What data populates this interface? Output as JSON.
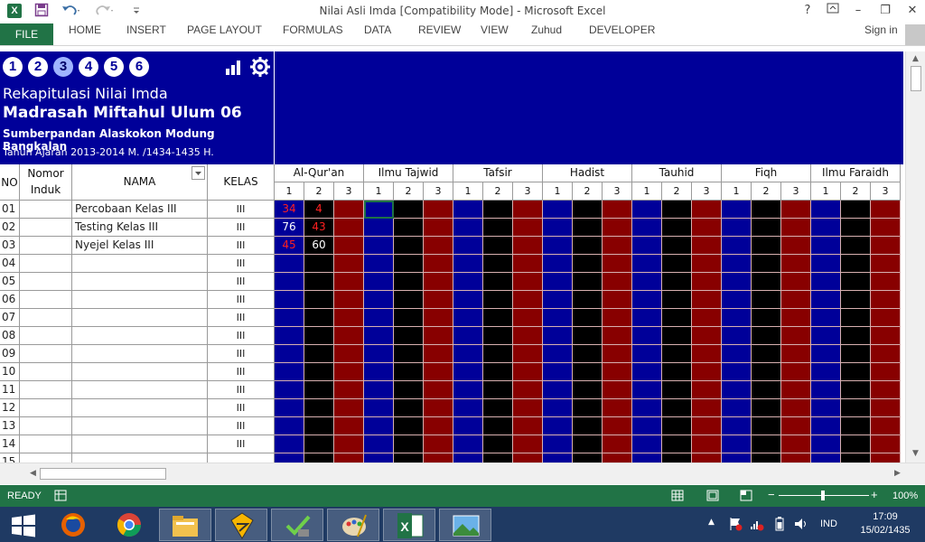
{
  "window": {
    "title": "Nilai Asli Imda  [Compatibility Mode] - Microsoft Excel",
    "help": "?",
    "minimize": "–",
    "restore": "❐",
    "close": "✕"
  },
  "ribbon": {
    "file": "FILE",
    "tabs": [
      "HOME",
      "INSERT",
      "PAGE LAYOUT",
      "FORMULAS",
      "DATA",
      "REVIEW",
      "VIEW",
      "Zuhud",
      "DEVELOPER"
    ],
    "signin": "Sign in"
  },
  "header": {
    "steps": [
      "1",
      "2",
      "3",
      "4",
      "5",
      "6"
    ],
    "active_step": "3",
    "subtitle": "Rekapitulasi Nilai Imda",
    "title": "Madrasah Miftahul Ulum 06",
    "address": "Sumberpandan Alaskokon Modung Bangkalan",
    "year": "Tahun Ajaran  2013-2014 M. /1434-1435 H."
  },
  "table": {
    "col_no": "NO",
    "col_nomor": "Nomor",
    "col_induk": "Induk",
    "col_nama": "NAMA",
    "col_kelas": "KELAS",
    "subjects": [
      "Al-Qur'an",
      "Ilmu Tajwid",
      "Tafsir",
      "Hadist",
      "Tauhid",
      "Fiqh",
      "Ilmu Faraidh"
    ],
    "sub_cols": [
      "1",
      "2",
      "3"
    ],
    "rows": [
      {
        "no": "01",
        "nama": "Percobaan Kelas III",
        "kelas": "III",
        "s1": "34",
        "s2": "4"
      },
      {
        "no": "02",
        "nama": "Testing Kelas III",
        "kelas": "III",
        "s1": "76",
        "s2": "43"
      },
      {
        "no": "03",
        "nama": "Nyejel Kelas III",
        "kelas": "III",
        "s1": "45",
        "s2": "60"
      },
      {
        "no": "04",
        "nama": "",
        "kelas": "III",
        "s1": "",
        "s2": ""
      },
      {
        "no": "05",
        "nama": "",
        "kelas": "III",
        "s1": "",
        "s2": ""
      },
      {
        "no": "06",
        "nama": "",
        "kelas": "III",
        "s1": "",
        "s2": ""
      },
      {
        "no": "07",
        "nama": "",
        "kelas": "III",
        "s1": "",
        "s2": ""
      },
      {
        "no": "08",
        "nama": "",
        "kelas": "III",
        "s1": "",
        "s2": ""
      },
      {
        "no": "09",
        "nama": "",
        "kelas": "III",
        "s1": "",
        "s2": ""
      },
      {
        "no": "10",
        "nama": "",
        "kelas": "III",
        "s1": "",
        "s2": ""
      },
      {
        "no": "11",
        "nama": "",
        "kelas": "III",
        "s1": "",
        "s2": ""
      },
      {
        "no": "12",
        "nama": "",
        "kelas": "III",
        "s1": "",
        "s2": ""
      },
      {
        "no": "13",
        "nama": "",
        "kelas": "III",
        "s1": "",
        "s2": ""
      },
      {
        "no": "14",
        "nama": "",
        "kelas": "III",
        "s1": "",
        "s2": ""
      },
      {
        "no": "15",
        "nama": "",
        "kelas": "",
        "s1": "",
        "s2": ""
      }
    ]
  },
  "score_colors": {
    "blue": "#000099",
    "black": "#000000",
    "red": "#880000",
    "fail_text": "#ff2020",
    "pass_text": "#ffffff"
  },
  "status": {
    "ready": "READY",
    "zoom": "100%"
  },
  "taskbar": {
    "lang": "IND",
    "time": "17:09",
    "date": "15/02/1435"
  }
}
